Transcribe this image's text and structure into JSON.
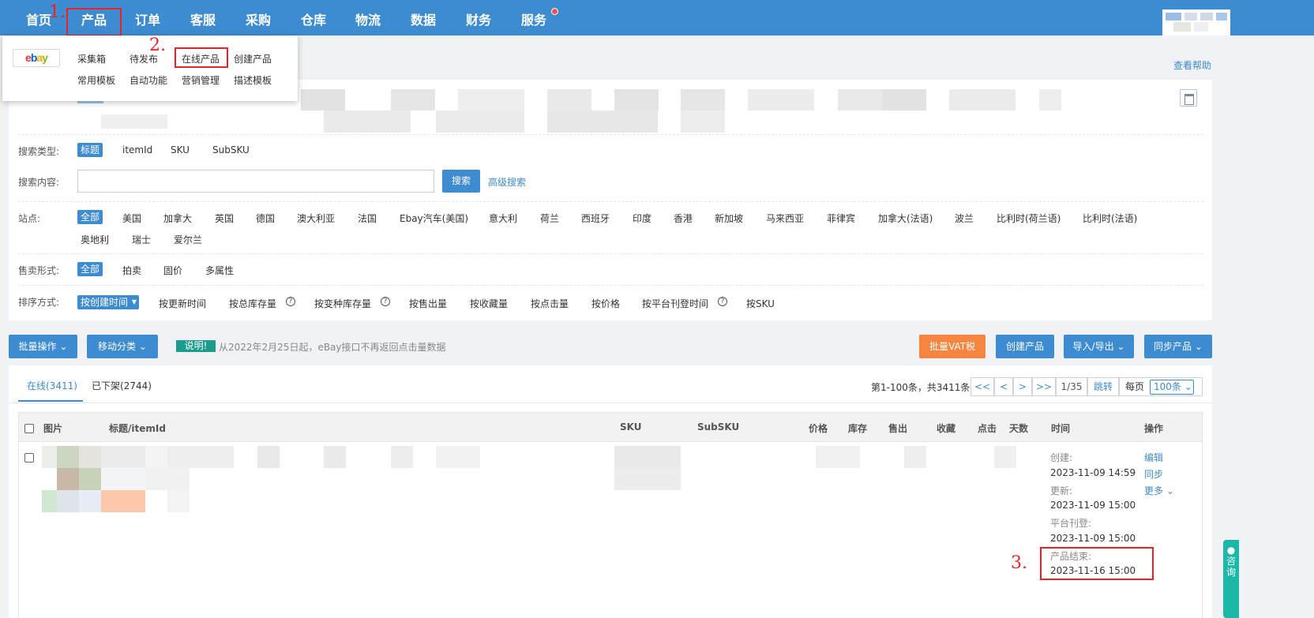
{
  "nav": {
    "items": [
      "首页",
      "产品",
      "订单",
      "客服",
      "采购",
      "仓库",
      "物流",
      "数据",
      "财务",
      "服务"
    ],
    "step1": "1.",
    "step2": "2.",
    "step3": "3."
  },
  "dropdown": {
    "logo": {
      "e": "e",
      "b": "b",
      "a": "a",
      "y": "y"
    },
    "items": [
      "采集箱",
      "待发布",
      "在线产品",
      "创建产品",
      "常用模板",
      "自动功能",
      "营销管理",
      "描述模板"
    ]
  },
  "help": "查看帮助",
  "filters": {
    "search_type_label": "搜索类型:",
    "search_types": [
      "标题",
      "itemId",
      "SKU",
      "SubSKU"
    ],
    "search_content_label": "搜索内容:",
    "search_placeholder": "",
    "search_button": "搜索",
    "advanced_search": "高级搜索",
    "site_label": "站点:",
    "sites": [
      "全部",
      "美国",
      "加拿大",
      "英国",
      "德国",
      "澳大利亚",
      "法国",
      "Ebay汽车(美国)",
      "意大利",
      "荷兰",
      "西班牙",
      "印度",
      "香港",
      "新加坡",
      "马来西亚",
      "菲律宾",
      "加拿大(法语)",
      "波兰",
      "比利时(荷兰语)",
      "比利时(法语)",
      "奥地利",
      "瑞士",
      "爱尔兰"
    ],
    "sale_type_label": "售卖形式:",
    "sale_types": [
      "全部",
      "拍卖",
      "固价",
      "多属性"
    ],
    "sort_label": "排序方式:",
    "sorts": [
      "按创建时间",
      "按更新时间",
      "按总库存量",
      "按变种库存量",
      "按售出量",
      "按收藏量",
      "按点击量",
      "按价格",
      "按平台刊登时间",
      "按SKU"
    ]
  },
  "actions": {
    "batch": "批量操作",
    "move": "移动分类",
    "note_tag": "说明!",
    "note_text": "从2022年2月25日起，eBay接口不再返回点击量数据",
    "vat": "批量VAT税",
    "create": "创建产品",
    "import_export": "导入/导出",
    "sync": "同步产品"
  },
  "tabs": [
    "在线(3411)",
    "已下架(2744)"
  ],
  "pager": {
    "summary": "第1-100条，共3411条",
    "first": "<<",
    "prev": "<",
    "next": ">",
    "last": ">>",
    "page": "1/35",
    "jump": "跳转",
    "per_page_label": "每页",
    "per_page": "100条"
  },
  "table": {
    "headers": [
      "图片",
      "标题/itemId",
      "SKU",
      "SubSKU",
      "价格",
      "库存",
      "售出",
      "收藏",
      "点击",
      "天数",
      "时间",
      "操作"
    ],
    "row": {
      "times": [
        {
          "label": "创建:",
          "value": "2023-11-09 14:59"
        },
        {
          "label": "更新:",
          "value": "2023-11-09 15:00"
        },
        {
          "label": "平台刊登:",
          "value": "2023-11-09 15:00"
        },
        {
          "label": "产品结束:",
          "value": "2023-11-16 15:00"
        }
      ],
      "ops": [
        "编辑",
        "同步",
        "更多"
      ]
    }
  },
  "side_widget": "咨询",
  "colors": {
    "nav_bg": "#3d8bd0",
    "accent": "#3d8bd0",
    "orange": "#f5853f",
    "teal": "#1a9c8c",
    "annotation_red": "#e8232a"
  }
}
